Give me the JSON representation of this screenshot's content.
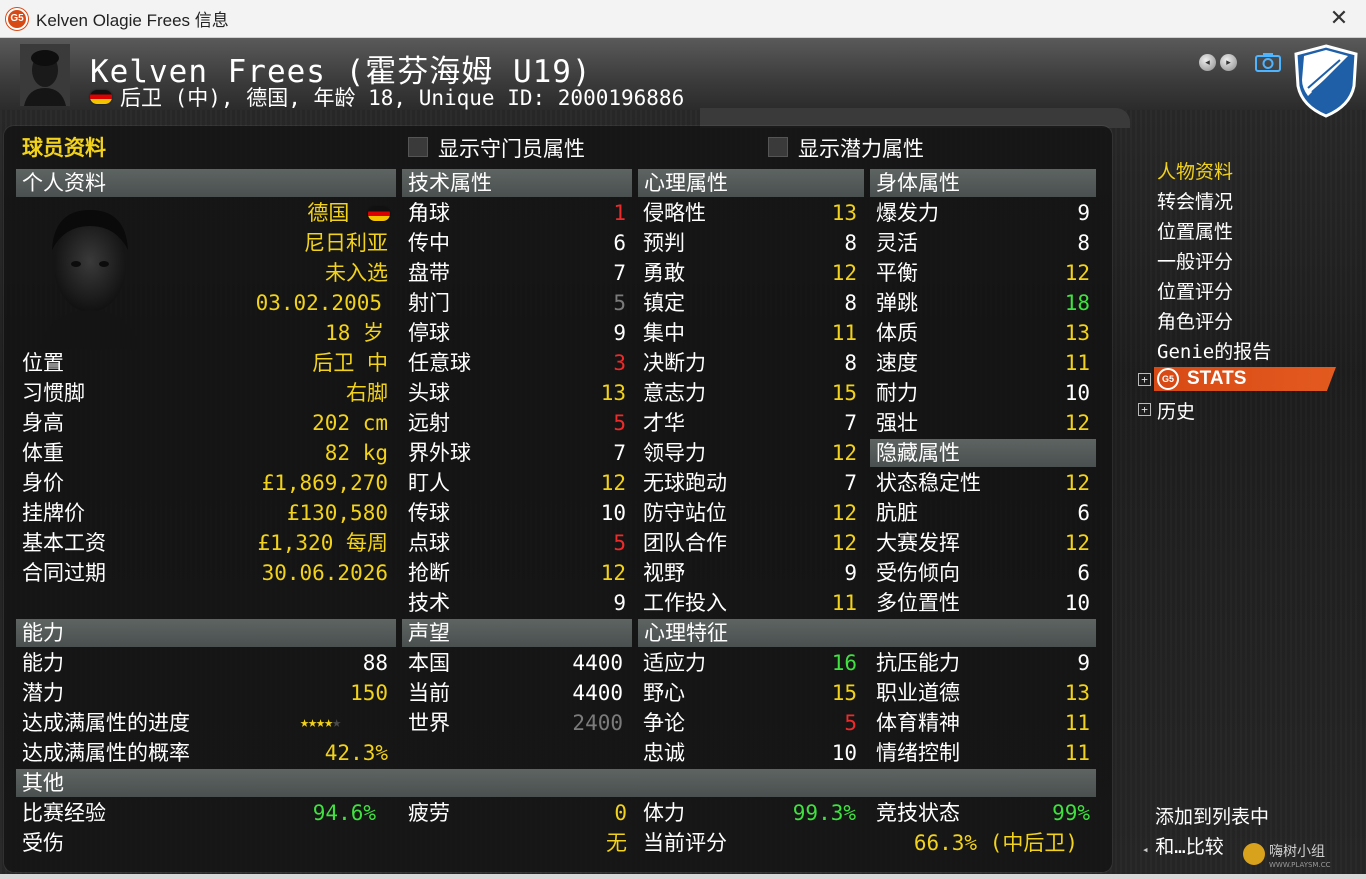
{
  "window": {
    "title": "Kelven Olagie Frees 信息",
    "logo": "G5",
    "close_symbol": "✕"
  },
  "header": {
    "player_name": "Kelven Frees (霍芬海姆 U19)",
    "subtitle": "后卫 (中), 德国, 年龄 18, Unique ID: 2000196886",
    "flag": "germany-flag-icon",
    "nav_prev": "◂",
    "nav_next": "▸"
  },
  "panel": {
    "title": "球员资料",
    "show_gk_label": "显示守门员属性",
    "show_potential_label": "显示潜力属性"
  },
  "personal": {
    "title": "个人资料",
    "nationality": "德国",
    "second_nationality": "尼日利亚",
    "international": "未入选",
    "birth_date": "03.02.2005",
    "age": "18 岁",
    "rows": [
      {
        "label": "位置",
        "value": "后卫 中"
      },
      {
        "label": "习惯脚",
        "value": "右脚"
      },
      {
        "label": "身高",
        "value": "202 cm"
      },
      {
        "label": "体重",
        "value": "82 kg"
      },
      {
        "label": "身价",
        "value": "£1,869,270"
      },
      {
        "label": "挂牌价",
        "value": "£130,580"
      },
      {
        "label": "基本工资",
        "value": "£1,320 每周"
      },
      {
        "label": "合同过期",
        "value": "30.06.2026"
      }
    ]
  },
  "ability": {
    "title": "能力",
    "rows": [
      {
        "label": "能力",
        "value": "88"
      },
      {
        "label": "潜力",
        "value": "150"
      },
      {
        "label": "达成满属性的进度",
        "value": ""
      },
      {
        "label": "达成满属性的概率",
        "value": "42.3%"
      }
    ],
    "stars": "★★★★",
    "stars_dim": "★",
    "stars_rating": 4
  },
  "technical": {
    "title": "技术属性",
    "rows": [
      {
        "label": "角球",
        "value": "1"
      },
      {
        "label": "传中",
        "value": "6"
      },
      {
        "label": "盘带",
        "value": "7"
      },
      {
        "label": "射门",
        "value": "5"
      },
      {
        "label": "停球",
        "value": "9"
      },
      {
        "label": "任意球",
        "value": "3"
      },
      {
        "label": "头球",
        "value": "13"
      },
      {
        "label": "远射",
        "value": "5"
      },
      {
        "label": "界外球",
        "value": "7"
      },
      {
        "label": "盯人",
        "value": "12"
      },
      {
        "label": "传球",
        "value": "10"
      },
      {
        "label": "点球",
        "value": "5"
      },
      {
        "label": "抢断",
        "value": "12"
      },
      {
        "label": "技术",
        "value": "9"
      }
    ]
  },
  "reputation": {
    "title": "声望",
    "rows": [
      {
        "label": "本国",
        "value": "4400"
      },
      {
        "label": "当前",
        "value": "4400"
      },
      {
        "label": "世界",
        "value": "2400"
      }
    ]
  },
  "mental": {
    "title": "心理属性",
    "rows": [
      {
        "label": "侵略性",
        "value": "13"
      },
      {
        "label": "预判",
        "value": "8"
      },
      {
        "label": "勇敢",
        "value": "12"
      },
      {
        "label": "镇定",
        "value": "8"
      },
      {
        "label": "集中",
        "value": "11"
      },
      {
        "label": "决断力",
        "value": "8"
      },
      {
        "label": "意志力",
        "value": "15"
      },
      {
        "label": "才华",
        "value": "7"
      },
      {
        "label": "领导力",
        "value": "12"
      },
      {
        "label": "无球跑动",
        "value": "7"
      },
      {
        "label": "防守站位",
        "value": "12"
      },
      {
        "label": "团队合作",
        "value": "12"
      },
      {
        "label": "视野",
        "value": "9"
      },
      {
        "label": "工作投入",
        "value": "11"
      }
    ]
  },
  "traits": {
    "title": "心理特征",
    "rows": [
      {
        "label": "适应力",
        "value": "16"
      },
      {
        "label": "野心",
        "value": "15"
      },
      {
        "label": "争论",
        "value": "5"
      },
      {
        "label": "忠诚",
        "value": "10"
      }
    ]
  },
  "physical": {
    "title": "身体属性",
    "rows": [
      {
        "label": "爆发力",
        "value": "9"
      },
      {
        "label": "灵活",
        "value": "8"
      },
      {
        "label": "平衡",
        "value": "12"
      },
      {
        "label": "弹跳",
        "value": "18"
      },
      {
        "label": "体质",
        "value": "13"
      },
      {
        "label": "速度",
        "value": "11"
      },
      {
        "label": "耐力",
        "value": "10"
      },
      {
        "label": "强壮",
        "value": "12"
      }
    ]
  },
  "hidden": {
    "title": "隐藏属性",
    "rows": [
      {
        "label": "状态稳定性",
        "value": "12"
      },
      {
        "label": "肮脏",
        "value": "6"
      },
      {
        "label": "大赛发挥",
        "value": "12"
      },
      {
        "label": "受伤倾向",
        "value": "6"
      },
      {
        "label": "多位置性",
        "value": "10"
      }
    ]
  },
  "extra_physical": {
    "rows": [
      {
        "label": "抗压能力",
        "value": "9"
      },
      {
        "label": "职业道德",
        "value": "13"
      },
      {
        "label": "体育精神",
        "value": "11"
      },
      {
        "label": "情绪控制",
        "value": "11"
      }
    ]
  },
  "other": {
    "title": "其他",
    "match_exp_label": "比赛经验",
    "match_exp_value": "94.6%",
    "injury_label": "受伤",
    "fatigue_label": "疲劳",
    "fatigue_value": "0",
    "fatigue_injury_value": "无",
    "stamina_label": "体力",
    "stamina_value": "99.3%",
    "rating_label": "当前评分",
    "rating_value": "66.3% (中后卫)",
    "form_label": "竞技状态",
    "form_value": "99%"
  },
  "menu": {
    "items": [
      "人物资料",
      "转会情况",
      "位置属性",
      "一般评分",
      "位置评分",
      "角色评分",
      "Genie的报告"
    ],
    "stats_label": "STATS",
    "stats_logo": "G5",
    "history": "历史",
    "add_to_list": "添加到列表中",
    "compare": "和…比较",
    "expand_symbol": "+"
  },
  "watermark": {
    "text": "嗨树小组",
    "url": "WWW.PLAYSM.CC"
  },
  "colors": {
    "accent_yellow": "#f2d21a",
    "good_green": "#3fe23f",
    "bad_red": "#ee2a2a",
    "muted_gray": "#7b7b7b",
    "stats_orange": "#d84a15"
  }
}
